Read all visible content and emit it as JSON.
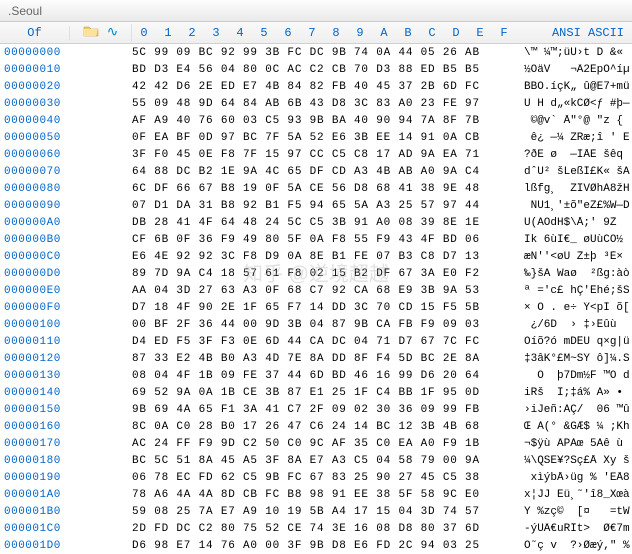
{
  "titlebar": {
    "text": "                              .Seoul"
  },
  "header": {
    "offset_label": "Of",
    "hex_cols": [
      "0",
      "1",
      "2",
      "3",
      "4",
      "5",
      "6",
      "7",
      "8",
      "9",
      "A",
      "B",
      "C",
      "D",
      "E",
      "F"
    ],
    "ascii_label": "ANSI ASCII"
  },
  "watermark": "知乎 @逆境超越",
  "rows": [
    {
      "offset": "00000000",
      "hex": "5C 99 09 BC 92 99 3B FC DC 9B 74 0A 44 05 26 AB",
      "ascii": "\\™ ¼™;üÜ›t D &«"
    },
    {
      "offset": "00000010",
      "hex": "BD D3 E4 56 04 80 0C AC C2 CB 70 D3 88 ED B5 B5",
      "ascii": "½ÓäV   ¬Â2ËpÓ^íµ"
    },
    {
      "offset": "00000020",
      "hex": "42 42 D6 2E ED E7 4B 84 82 FB 40 45 37 2B 6D FC",
      "ascii": "BBÖ.íçK„ û@E7+mü"
    },
    {
      "offset": "00000030",
      "hex": "55 09 48 9D 64 84 AB 6B 43 D8 3C 83 A0 23 FE 97",
      "ascii": "U H d„«kCØ<ƒ #þ—"
    },
    {
      "offset": "00000040",
      "hex": "AF A9 40 76 60 03 C5 93 9B BA 40 90 94 7A 8F 7B",
      "ascii": "¯©@v` Å\"°@ \"z {"
    },
    {
      "offset": "00000050",
      "hex": "0F EA BF 0D 97 BC 7F 5A 52 E6 3B EE 14 91 0A CB",
      "ascii": " ê¿ —¼ ZRæ;î ' Ë"
    },
    {
      "offset": "00000060",
      "hex": "3F F0 45 0E F8 7F 15 97 CC C5 C8 17 AD 9A EA 71",
      "ascii": "?ðE ø  —ÌÅÈ ­šêq"
    },
    {
      "offset": "00000070",
      "hex": "64 88 DC B2 1E 9A 4C 65 DF CD A3 4B AB A0 9A C4",
      "ascii": "dˆÜ² šLeßÍ£K« šÄ"
    },
    {
      "offset": "00000080",
      "hex": "6C DF 66 67 B8 19 0F 5A CE 56 D8 68 41 38 9E 48",
      "ascii": "lßfg¸  ZÎVØhA8žH"
    },
    {
      "offset": "00000090",
      "hex": "07 D1 DA 31 B8 92 B1 F5 94 65 5A A3 25 57 97 44",
      "ascii": " ÑÚ1¸'±õ\"eZ£%W—D"
    },
    {
      "offset": "000000A0",
      "hex": "DB 28 41 4F 64 48 24 5C C5 3B 91 A0 08 39 8E 1E",
      "ascii": "Û(AOdH$\\Å;' 9Ž "
    },
    {
      "offset": "000000B0",
      "hex": "CF 6B 0F 36 F9 49 80 5F 0A F8 55 F9 43 4F BD 06",
      "ascii": "Ïk 6ùI€_ øUùCO½ "
    },
    {
      "offset": "000000C0",
      "hex": "E6 4E 92 92 3C F8 D9 0A 8E B1 FE 07 B3 C8 D7 13",
      "ascii": "æN''<øÙ Ž±þ ³È× "
    },
    {
      "offset": "000000D0",
      "hex": "89 7D 9A C4 18 57 61 F8 02 15 B2 DF 67 3A E0 F2",
      "ascii": "‰}šÄ Waø  ²ßg:àò"
    },
    {
      "offset": "000000E0",
      "hex": "AA 04 3D 27 63 A3 0F 68 C7 92 CA 68 E9 3B 9A 53",
      "ascii": "ª ='c£ hÇ'Êhé;šS"
    },
    {
      "offset": "000000F0",
      "hex": "D7 18 4F 90 2E 1F 65 F7 14 DD 3C 70 CD 15 F5 5B",
      "ascii": "× O . e÷ Ý<pÍ õ["
    },
    {
      "offset": "00000100",
      "hex": "00 BF 2F 36 44 00 9D 3B 04 87 9B CA FB F9 09 03",
      "ascii": " ¿/6D  › ‡›Êûù  "
    },
    {
      "offset": "00000110",
      "hex": "D4 ED F5 3F F3 0E 6D 44 CA DC 04 71 D7 67 7C FC",
      "ascii": "Ôíõ?ó mDÊÜ q×g|ü"
    },
    {
      "offset": "00000120",
      "hex": "87 33 E2 4B B0 A3 4D 7E 8A DD 8F F4 5D BC 2E 8A",
      "ascii": "‡3âK°£M~ŠÝ ô]¼.Š"
    },
    {
      "offset": "00000130",
      "hex": "08 04 4F 1B 09 FE 37 44 6D BD 46 16 99 D6 20 64",
      "ascii": "  O  þ7Dm½F ™Ö d"
    },
    {
      "offset": "00000140",
      "hex": "69 52 9A 0A 1B CE 3B 87 E1 25 1F C4 BB 1F 95 0D",
      "ascii": "iRš  Î;‡á% Ä» • "
    },
    {
      "offset": "00000150",
      "hex": "9B 69 4A 65 F1 3A 41 C7 2F 09 02 30 36 09 99 FB",
      "ascii": "›iJeñ:AÇ/  06 ™û"
    },
    {
      "offset": "00000160",
      "hex": "8C 0A C0 28 B0 17 26 47 C6 24 14 BC 12 3B 4B 68",
      "ascii": "Œ À(° &GÆ$ ¼ ;Kh"
    },
    {
      "offset": "00000170",
      "hex": "AC 24 FF F9 9D C2 50 C0 9C AF 35 C0 EA A0 F9 1B",
      "ascii": "¬$ÿù ÂPÀœ¯5Àê ù "
    },
    {
      "offset": "00000180",
      "hex": "BC 5C 51 8A 45 A5 3F 8A E7 A3 C5 04 58 79 00 9A",
      "ascii": "¼\\QŠE¥?Šç£Å Xy š"
    },
    {
      "offset": "00000190",
      "hex": "06 78 EC FD 62 C5 9B FC 67 83 25 90 27 45 C5 38",
      "ascii": " xìýbÅ›üg % 'EÅ8"
    },
    {
      "offset": "000001A0",
      "hex": "78 A6 4A 4A 8D CB FC B8 98 91 EE 38 5F 58 9C E0",
      "ascii": "x¦JJ Ëü¸˜'î8_Xœà"
    },
    {
      "offset": "000001B0",
      "hex": "59 08 25 7A E7 A9 10 19 5B A4 17 15 04 3D 74 57",
      "ascii": "Y %zç©  [¤   =tW"
    },
    {
      "offset": "000001C0",
      "hex": "2D FD DC C2 80 75 52 CE 74 3E 16 08 D8 80 37 6D",
      "ascii": "-ýÜÂ€uRÎt>  Ø€7m"
    },
    {
      "offset": "000001D0",
      "hex": "D6 98 E7 14 76 A0 00 3F 9B D8 E6 FD 2C 94 03 25",
      "ascii": "Ö˜ç v  ?›Øæý,\" %"
    }
  ]
}
